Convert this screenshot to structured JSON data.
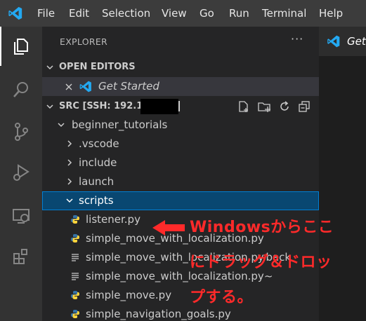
{
  "menu": {
    "items": [
      "File",
      "Edit",
      "Selection",
      "View",
      "Go",
      "Run",
      "Terminal",
      "Help"
    ]
  },
  "explorer": {
    "title": "EXPLORER",
    "more": "···"
  },
  "open_editors": {
    "header": "OPEN EDITORS",
    "items": [
      {
        "label": "Get Started"
      }
    ]
  },
  "workspace": {
    "header": "SRC [SSH: 192.168",
    "tree": [
      {
        "label": "beginner_tutorials"
      },
      {
        "label": ".vscode"
      },
      {
        "label": "include"
      },
      {
        "label": "launch"
      },
      {
        "label": "scripts"
      },
      {
        "label": "listener.py"
      },
      {
        "label": "simple_move_with_localization.py"
      },
      {
        "label": "simple_move_with_localization.py.back"
      },
      {
        "label": "simple_move_with_localization.py~"
      },
      {
        "label": "simple_move.py"
      },
      {
        "label": "simple_navigation_goals.py"
      }
    ]
  },
  "editor": {
    "tab_label": "Get"
  },
  "annotation": {
    "line1": "Windowsからここ",
    "line2": "にドラッグ＆ドロッ",
    "line3": "プする。"
  },
  "colors": {
    "accent": "#007acc",
    "selection": "#094771",
    "annotation": "#ff2a2a",
    "python_blue": "#3572a5",
    "python_yellow": "#ffd43b"
  }
}
